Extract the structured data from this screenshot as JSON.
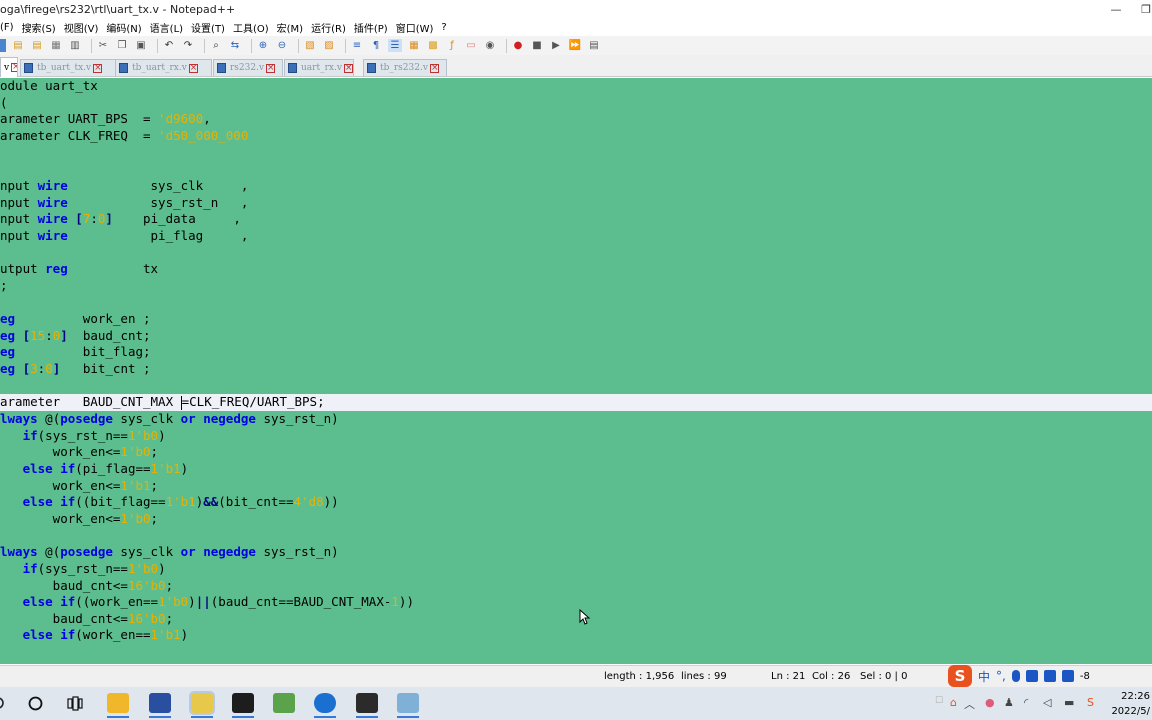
{
  "window": {
    "title": "oga\\firege\\rs232\\rtl\\uart_tx.v - Notepad++",
    "minimize": "—",
    "restore": "❐"
  },
  "menu": [
    "(F)",
    "搜索(S)",
    "视图(V)",
    "编码(N)",
    "语言(L)",
    "设置(T)",
    "工具(O)",
    "宏(M)",
    "运行(R)",
    "插件(P)",
    "窗口(W)",
    "?"
  ],
  "tabs": [
    {
      "label": "v",
      "active": true
    },
    {
      "label": "tb_uart_tx.v",
      "active": false
    },
    {
      "label": "tb_uart_rx.v",
      "active": false
    },
    {
      "label": "rs232.v",
      "active": false
    },
    {
      "label": "uart_rx.v",
      "active": false
    },
    {
      "label": "tb_rs232.v",
      "active": false
    }
  ],
  "code": [
    {
      "t": [
        [
          "kw",
          ""
        ],
        [
          "",
          "odule uart_tx"
        ]
      ]
    },
    {
      "t": [
        [
          "",
          "("
        ]
      ]
    },
    {
      "t": [
        [
          "",
          "arameter UART_BPS  = "
        ],
        [
          "num",
          "'d9600"
        ],
        [
          "",
          ","
        ]
      ]
    },
    {
      "t": [
        [
          "",
          "arameter CLK_FREQ  = "
        ],
        [
          "num",
          "'d50_000_000"
        ]
      ]
    },
    {
      "t": []
    },
    {
      "t": []
    },
    {
      "t": [
        [
          "",
          "nput "
        ],
        [
          "kw",
          "wire"
        ],
        [
          "",
          "           sys_clk     ,"
        ]
      ]
    },
    {
      "t": [
        [
          "",
          "nput "
        ],
        [
          "kw",
          "wire"
        ],
        [
          "",
          "           sys_rst_n   ,"
        ]
      ]
    },
    {
      "t": [
        [
          "",
          "nput "
        ],
        [
          "kw",
          "wire"
        ],
        [
          "",
          ""
        ],
        [
          "op",
          " ["
        ],
        [
          "num",
          "7"
        ],
        [
          "",
          ":"
        ],
        [
          "num",
          "0"
        ],
        [
          "op",
          "]"
        ],
        [
          "",
          "    pi_data     ,"
        ]
      ]
    },
    {
      "t": [
        [
          "",
          "nput "
        ],
        [
          "kw",
          "wire"
        ],
        [
          "",
          "           pi_flag     ,"
        ]
      ]
    },
    {
      "t": []
    },
    {
      "t": [
        [
          "",
          "utput "
        ],
        [
          "kw",
          "reg"
        ],
        [
          "",
          "          tx"
        ]
      ]
    },
    {
      "t": [
        [
          "",
          ";"
        ]
      ]
    },
    {
      "t": []
    },
    {
      "t": [
        [
          "kw",
          "eg"
        ],
        [
          "",
          "         work_en ;"
        ]
      ]
    },
    {
      "t": [
        [
          "kw",
          "eg"
        ],
        [
          "op",
          " ["
        ],
        [
          "num",
          "15"
        ],
        [
          "",
          ":"
        ],
        [
          "num",
          "0"
        ],
        [
          "op",
          "]"
        ],
        [
          "",
          "  baud_cnt;"
        ]
      ]
    },
    {
      "t": [
        [
          "kw",
          "eg"
        ],
        [
          "",
          "         bit_flag;"
        ]
      ]
    },
    {
      "t": [
        [
          "kw",
          "eg"
        ],
        [
          "op",
          " ["
        ],
        [
          "num",
          "3"
        ],
        [
          "",
          ":"
        ],
        [
          "num",
          "0"
        ],
        [
          "op",
          "]"
        ],
        [
          "",
          "   bit_cnt ;"
        ]
      ]
    },
    {
      "t": []
    },
    {
      "t": [
        [
          "",
          "arameter   BAUD_CNT_MAX "
        ],
        [
          "caret",
          ""
        ],
        [
          "",
          "=CLK_FREQ/UART_BPS;"
        ]
      ],
      "cur": true
    },
    {
      "t": [
        [
          "kw",
          "lways"
        ],
        [
          "",
          " @("
        ],
        [
          "kw",
          "posedge"
        ],
        [
          "",
          " sys_clk "
        ],
        [
          "kw",
          "or"
        ],
        [
          "",
          ""
        ],
        [
          "kw",
          " negedge"
        ],
        [
          "",
          " sys_rst_n)"
        ]
      ]
    },
    {
      "t": [
        [
          "",
          "   "
        ],
        [
          "kw",
          "if"
        ],
        [
          "",
          "(sys_rst_n=="
        ],
        [
          "num",
          "1'b0"
        ],
        [
          "",
          ")"
        ]
      ]
    },
    {
      "t": [
        [
          "",
          "       work_en<="
        ],
        [
          "num",
          "1'b0"
        ],
        [
          "",
          ";"
        ]
      ]
    },
    {
      "t": [
        [
          "",
          "   "
        ],
        [
          "kw",
          "else if"
        ],
        [
          "",
          "(pi_flag=="
        ],
        [
          "num",
          "1'b1"
        ],
        [
          "",
          ")"
        ]
      ]
    },
    {
      "t": [
        [
          "",
          "       work_en<="
        ],
        [
          "num",
          "1'b1"
        ],
        [
          "",
          ";"
        ]
      ]
    },
    {
      "t": [
        [
          "",
          "   "
        ],
        [
          "kw",
          "else if"
        ],
        [
          "",
          "((bit_flag=="
        ],
        [
          "num",
          "1'b1"
        ],
        [
          "",
          ")"
        ],
        [
          "op",
          "&&"
        ],
        [
          "",
          "(bit_cnt=="
        ],
        [
          "num",
          "4'd8"
        ],
        [
          "",
          "))"
        ]
      ]
    },
    {
      "t": [
        [
          "",
          "       work_en<="
        ],
        [
          "num",
          "1'b0"
        ],
        [
          "",
          ";"
        ]
      ]
    },
    {
      "t": []
    },
    {
      "t": [
        [
          "kw",
          "lways"
        ],
        [
          "",
          " @("
        ],
        [
          "kw",
          "posedge"
        ],
        [
          "",
          " sys_clk "
        ],
        [
          "kw",
          "or"
        ],
        [
          "",
          ""
        ],
        [
          "kw",
          " negedge"
        ],
        [
          "",
          " sys_rst_n)"
        ]
      ]
    },
    {
      "t": [
        [
          "",
          "   "
        ],
        [
          "kw",
          "if"
        ],
        [
          "",
          "(sys_rst_n=="
        ],
        [
          "num",
          "1'b0"
        ],
        [
          "",
          ")"
        ]
      ]
    },
    {
      "t": [
        [
          "",
          "       baud_cnt<="
        ],
        [
          "num",
          "16'b0"
        ],
        [
          "",
          ";"
        ]
      ]
    },
    {
      "t": [
        [
          "",
          "   "
        ],
        [
          "kw",
          "else if"
        ],
        [
          "",
          "((work_en=="
        ],
        [
          "num",
          "1'b0"
        ],
        [
          "",
          ")"
        ],
        [
          "op",
          "||"
        ],
        [
          "",
          "(baud_cnt==BAUD_CNT_MAX-"
        ],
        [
          "num",
          "1"
        ],
        [
          "",
          "))"
        ]
      ]
    },
    {
      "t": [
        [
          "",
          "       baud_cnt<="
        ],
        [
          "num",
          "16'b0"
        ],
        [
          "",
          ";"
        ]
      ]
    },
    {
      "t": [
        [
          "",
          "   "
        ],
        [
          "kw",
          "else if"
        ],
        [
          "",
          "(work_en=="
        ],
        [
          "num",
          "1'b1"
        ],
        [
          "",
          ")"
        ]
      ]
    }
  ],
  "status": {
    "length": "length : 1,956",
    "lines": "lines : 99",
    "ln": "Ln : 21",
    "col": "Col : 26",
    "sel": "Sel : 0 | 0"
  },
  "ime": {
    "logo": "S",
    "lang": "中",
    "punct": "°,",
    "suffix": "-8"
  },
  "taskbar": {
    "time": "22:26",
    "date": "2022/5/"
  }
}
